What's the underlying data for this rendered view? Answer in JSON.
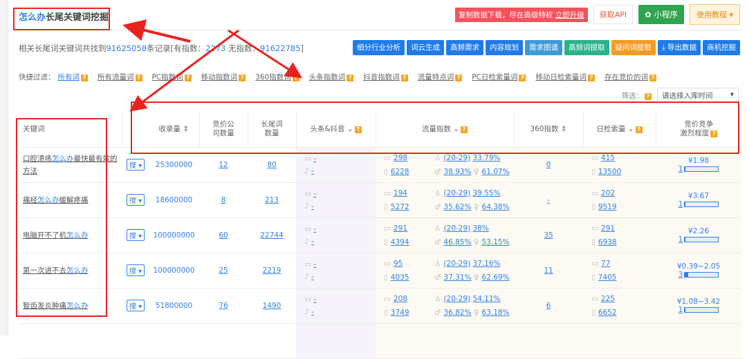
{
  "title": {
    "highlight": "怎么办",
    "rest": "长尾关键词挖掘"
  },
  "top": {
    "promo": "复制数据下载，尽在高级特权",
    "promo_link": "立即升级",
    "api": "获取API",
    "mini": "小程序",
    "tutorial": "使用教程 ▾"
  },
  "stats": {
    "prefix": "相关长尾词关键词共找到",
    "total": "91625058",
    "mid": "条记录[有指数：",
    "with_index": "2273",
    "mid2": " 无指数：",
    "without_index": "91622785",
    "suffix": "]"
  },
  "actions": [
    "细分行业分析",
    "词云生成",
    "高频需求",
    "内容规划",
    "需求图谱",
    "高频词提取",
    "疑问词提取",
    "⤓ 导出数据",
    "商机挖掘"
  ],
  "action_colors": [
    "#1f7be8",
    "#1f7be8",
    "#1f7be8",
    "#1f7be8",
    "#3d9ad8",
    "#2bb38a",
    "#f59a23",
    "#1f7be8",
    "#1f7be8"
  ],
  "filters": {
    "label": "快捷过滤：",
    "items": [
      "所有词",
      "所有流量词",
      "PC指数词",
      "移动指数词",
      "360指数词",
      "头条指数词",
      "抖音指数词",
      "流量特点词",
      "PC日检索量词",
      "移动日检索量词",
      "存在竞价的词"
    ]
  },
  "screen": {
    "label": "筛选：",
    "placeholder": "请选择入库时间",
    "arrow": "▾"
  },
  "columns": {
    "keyword": "关键词",
    "indexed": "收录量 ⇕",
    "bid_companies": "竞价公\n司数量",
    "longtail": "长尾词\n数量",
    "toutiao": "头条&抖音 ⌄",
    "traffic": "流量指数 ⌄",
    "i360": "360指数 ⇕",
    "daily": "日检索量 ⌄",
    "competition": "竞价竞争\n激烈程度"
  },
  "search_btn": "搜 ▾",
  "rows": [
    {
      "pre": "口腔溃疡",
      "hl": "怎么办",
      "post": "最快最有效的方法",
      "indexed": "25300000",
      "bid": "12",
      "longtail": "80",
      "tt": "-",
      "dy": "-",
      "pc": "298",
      "mob": "6228",
      "age": "(20-29)",
      "age_pct": "33.79%",
      "male": "38.93%",
      "female": "61.07%",
      "i360": "0",
      "d_pc": "415",
      "d_mob": "13500",
      "price": "¥1.98",
      "level": "1",
      "level_frac": 0.02
    },
    {
      "pre": "痛经",
      "hl": "怎么办",
      "post": "缓解疼痛",
      "indexed": "18600000",
      "bid": "8",
      "longtail": "213",
      "tt": "-",
      "dy": "-",
      "pc": "194",
      "mob": "5272",
      "age": "(20-29)",
      "age_pct": "39.55%",
      "male": "35.62%",
      "female": "64.38%",
      "i360": "-",
      "d_pc": "202",
      "d_mob": "9519",
      "price": "¥3.67",
      "level": "1",
      "level_frac": 0.02
    },
    {
      "pre": "电脑开不了机",
      "hl": "怎么办",
      "post": "",
      "indexed": "100000000",
      "bid": "60",
      "longtail": "22744",
      "tt": "-",
      "dy": "-",
      "pc": "291",
      "mob": "4394",
      "age": "(20-29)",
      "age_pct": "38%",
      "male": "46.85%",
      "female": "53.15%",
      "i360": "35",
      "d_pc": "291",
      "d_mob": "6938",
      "price": "¥2.26",
      "level": "1",
      "level_frac": 0.02
    },
    {
      "pre": "第一次进不去",
      "hl": "怎么办",
      "post": "",
      "indexed": "100000000",
      "bid": "25",
      "longtail": "2219",
      "tt": "-",
      "dy": "-",
      "pc": "95",
      "mob": "4035",
      "age": "(20-29)",
      "age_pct": "37.16%",
      "male": "37.31%",
      "female": "62.69%",
      "i360": "11",
      "d_pc": "77",
      "d_mob": "7405",
      "price": "¥0.39~2.05",
      "level": "3",
      "level_frac": 0.1
    },
    {
      "pre": "智齿发炎肿痛",
      "hl": "怎么办",
      "post": "",
      "indexed": "51800000",
      "bid": "76",
      "longtail": "1490",
      "tt": "-",
      "dy": "-",
      "pc": "208",
      "mob": "3749",
      "age": "(20-29)",
      "age_pct": "54.11%",
      "male": "36.82%",
      "female": "63.18%",
      "i360": "6",
      "d_pc": "225",
      "d_mob": "6652",
      "price": "¥1.08~3.42",
      "level": "1",
      "level_frac": 0.02
    }
  ]
}
